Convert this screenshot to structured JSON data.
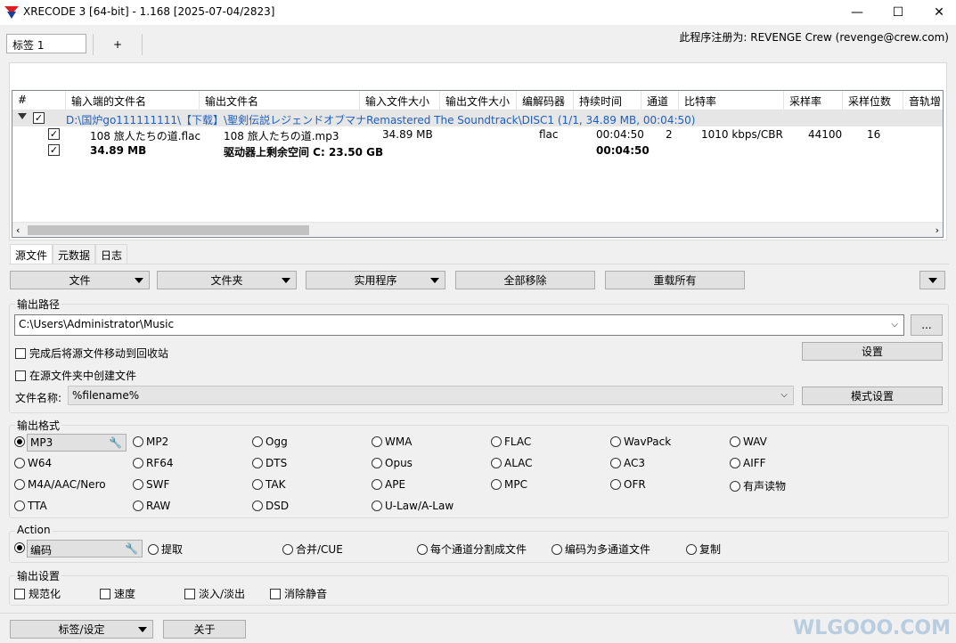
{
  "window": {
    "title": "XRECODE 3 [64-bit] - 1.168 [2025-07-04/2823]",
    "minimize": "—",
    "maximize": "☐",
    "close": "✕"
  },
  "tabs": {
    "active_tab": "标签 1",
    "add_tab": "+"
  },
  "registration": "此程序注册为: REVENGE Crew (revenge@crew.com)",
  "grid": {
    "columns": [
      "#",
      "输入端的文件名",
      "输出文件名",
      "输入文件大小",
      "输出文件大小",
      "编解码器",
      "持续时间",
      "通道",
      "比特率",
      "采样率",
      "采样位数",
      "音轨增"
    ],
    "group_path": "D:\\国炉go111111111\\【下载】\\聖剣伝説レジェンドオブマナRemastered The Soundtrack\\DISC1 (1/1, 34.89 MB, 00:04:50)",
    "rows": [
      {
        "input_name": "108 旅人たちの道.flac",
        "output_name": "108 旅人たちの道.mp3",
        "input_size": "34.89 MB",
        "codec": "flac",
        "duration": "00:04:50",
        "channels": "2",
        "bitrate": "1010 kbps/CBR",
        "samplerate": "44100",
        "bits": "16"
      }
    ],
    "summary": {
      "total_size": "34.89 MB",
      "free_space": "驱动器上剩余空间 C: 23.50 GB",
      "total_duration": "00:04:50"
    },
    "check_mark": "✓"
  },
  "bottom_tabs": [
    "源文件",
    "元数据",
    "日志"
  ],
  "toolbar": {
    "file": "文件",
    "folder": "文件夹",
    "utilities": "实用程序",
    "remove_all": "全部移除",
    "reload_all": "重载所有"
  },
  "output_path": {
    "label": "输出路径",
    "value": "C:\\Users\\Administrator\\Music",
    "browse": "...",
    "move_to_recycle": "完成后将源文件移动到回收站",
    "create_in_source": "在源文件夹中创建文件",
    "settings": "设置",
    "filename_label": "文件名称:",
    "filename_value": "%filename%",
    "pattern_settings": "模式设置"
  },
  "output_format": {
    "label": "输出格式",
    "selected": "MP3",
    "options": [
      [
        "MP3",
        "MP2",
        "Ogg",
        "WMA",
        "FLAC",
        "WavPack",
        "WAV"
      ],
      [
        "W64",
        "RF64",
        "DTS",
        "Opus",
        "ALAC",
        "AC3",
        "AIFF"
      ],
      [
        "M4A/AAC/Nero",
        "SWF",
        "TAK",
        "APE",
        "MPC",
        "OFR",
        "有声读物"
      ],
      [
        "TTA",
        "RAW",
        "DSD",
        "U-Law/A-Law"
      ]
    ]
  },
  "action": {
    "label": "Action",
    "selected": "编码",
    "options": [
      "提取",
      "合并/CUE",
      "每个通道分割成文件",
      "编码为多通道文件",
      "复制"
    ]
  },
  "output_settings": {
    "label": "输出设置",
    "normalize": "规范化",
    "speed": "速度",
    "fade": "淡入/淡出",
    "remove_silence": "消除静音"
  },
  "footer": {
    "tabs_settings": "标签/设定",
    "about": "关于",
    "watermark": "WLGOOO.COM"
  },
  "colors": {
    "accent_blue": "#1f5fbf",
    "logo_red": "#d81e1e",
    "logo_blue": "#1c3f9c"
  }
}
